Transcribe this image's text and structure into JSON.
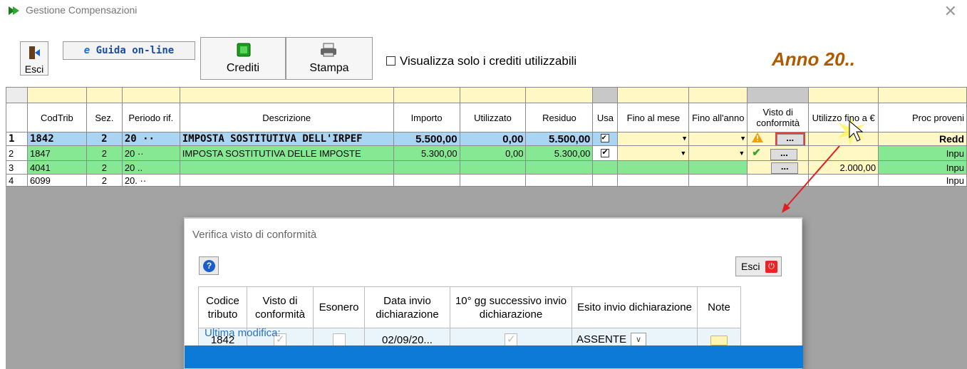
{
  "window": {
    "title": "Gestione Compensazioni"
  },
  "toolbar": {
    "esci_label": "Esci",
    "guida_label": "Guida on-line",
    "crediti_label": "Crediti",
    "stampa_label": "Stampa",
    "checkbox_label": "Visualizza solo i crediti utilizzabili",
    "checkbox_checked": false,
    "anno_label": "Anno 20.."
  },
  "grid": {
    "columns": [
      "CodTrib",
      "Sez.",
      "Periodo rif.",
      "Descrizione",
      "Importo",
      "Utilizzato",
      "Residuo",
      "Usa",
      "Fino al mese",
      "Fino all'anno",
      "Visto di conformità",
      "Utilizzo fino a €",
      "Proc proveni"
    ],
    "rows": [
      {
        "num": "1",
        "codtrib": "1842",
        "sez": "2",
        "periodo": "20 ··",
        "descrizione": "IMPOSTA SOSTITUTIVA DELL'IRPEF",
        "importo": "5.500,00",
        "utilizzato": "0,00",
        "residuo": "5.500,00",
        "usa": true,
        "visto": "warning",
        "utilizzo": "",
        "proc": "Redd"
      },
      {
        "num": "2",
        "codtrib": "1847",
        "sez": "2",
        "periodo": "20 ··",
        "descrizione": "IMPOSTA SOSTITUTIVA DELLE IMPOSTE",
        "importo": "5.300,00",
        "utilizzato": "0,00",
        "residuo": "5.300,00",
        "usa": true,
        "visto": "check",
        "utilizzo": "",
        "proc": "Inpu"
      },
      {
        "num": "3",
        "codtrib": "4041",
        "sez": "2",
        "periodo": "20 ..",
        "descrizione": "",
        "importo": "",
        "utilizzato": "",
        "residuo": "",
        "usa": false,
        "visto": "",
        "utilizzo": "2.000,00",
        "proc": "Inpu"
      },
      {
        "num": "4",
        "codtrib": "6099",
        "sez": "2",
        "periodo": "20. ··",
        "descrizione": "",
        "importo": "",
        "utilizzato": "",
        "residuo": "",
        "usa": false,
        "visto": "",
        "utilizzo": "",
        "proc": "Inpu"
      }
    ],
    "ellipsis": "..."
  },
  "dialog": {
    "title": "Verifica visto di conformità",
    "esci_label": "Esci",
    "columns": [
      "Codice tributo",
      "Visto di conformità",
      "Esonero",
      "Data invio dichiarazione",
      "10° gg successivo invio dichiarazione",
      "Esito invio dichiarazione",
      "Note"
    ],
    "row": {
      "codice": "1842",
      "visto_checked": true,
      "esonero_checked": false,
      "data_invio": "02/09/20...",
      "decimo_checked": true,
      "esito": "ASSENTE"
    },
    "ultima_modifica_label": "Ultima modifica:"
  },
  "colors": {
    "row_selected": "#a9d4f2",
    "row_green": "#86e893",
    "filter_yellow": "#fff8c4",
    "anno": "#b05a00",
    "dialog_bar": "#0d7ad7",
    "arrow": "#e02020"
  }
}
